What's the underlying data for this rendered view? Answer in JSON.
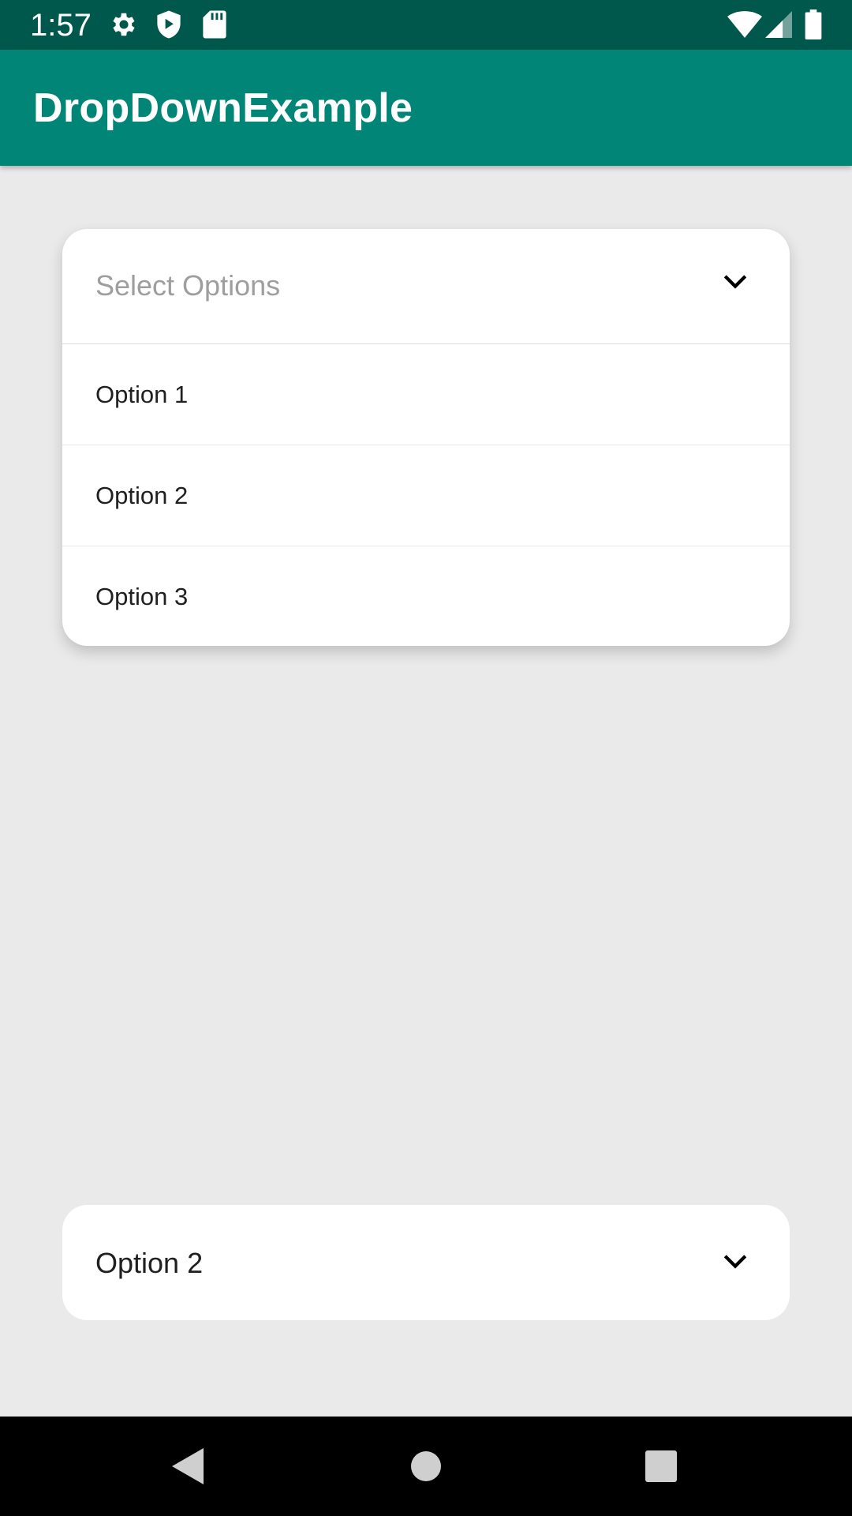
{
  "status_bar": {
    "time": "1:57",
    "icons": [
      "gear-icon",
      "shield-play-icon",
      "sd-card-icon",
      "wifi-icon",
      "signal-icon",
      "battery-icon"
    ]
  },
  "app_bar": {
    "title": "DropDownExample",
    "color": "#008577"
  },
  "dropdown_1": {
    "placeholder": "Select Options",
    "expanded": true,
    "options": [
      {
        "label": "Option 1"
      },
      {
        "label": "Option 2"
      },
      {
        "label": "Option 3"
      }
    ]
  },
  "dropdown_2": {
    "selected_value": "Option 2",
    "expanded": false
  },
  "nav_bar": {
    "buttons": [
      "back-icon",
      "home-icon",
      "recents-icon"
    ]
  },
  "colors": {
    "status_bar": "#00574B",
    "app_bar": "#008577",
    "background": "#EAEAEA"
  }
}
